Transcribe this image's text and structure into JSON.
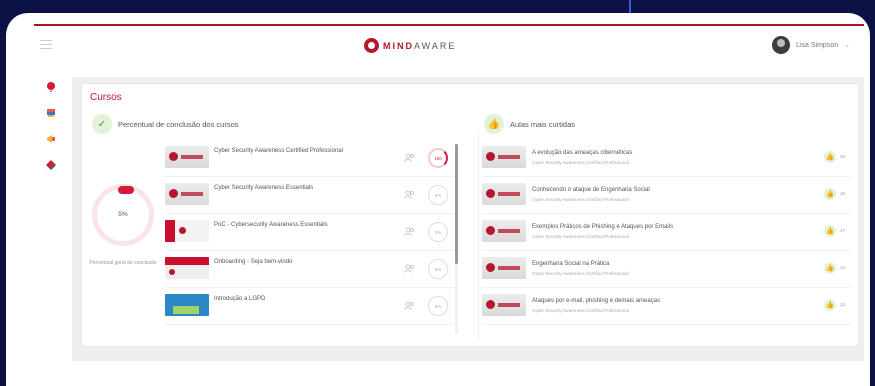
{
  "header": {
    "brand_bold": "MIND",
    "brand_rest": "AWARE",
    "user_name": "Lisa Simpson"
  },
  "sidebar": {
    "items": [
      {
        "icon": "balloon-icon"
      },
      {
        "icon": "graduation-cap-icon"
      },
      {
        "icon": "megaphone-icon"
      },
      {
        "icon": "diamond-icon"
      }
    ]
  },
  "main": {
    "title": "Cursos",
    "completion_section": {
      "heading": "Percentual de conclusão dos cursos",
      "overall_value": "5%",
      "overall_label": "Percentual geral de conclusão"
    },
    "courses": [
      {
        "title": "Cyber Security Awareness Certified Professional",
        "progress": "100",
        "progress_pct": 100,
        "thumb": "grey"
      },
      {
        "title": "Cyber Security Awareness Essentials",
        "progress": "0%",
        "progress_pct": 0,
        "thumb": "grey"
      },
      {
        "title": "PoC - Cybersecurity Awareness Essentials",
        "progress": "0%",
        "progress_pct": 0,
        "thumb": "poc"
      },
      {
        "title": "Onboarding - Seja bem-vindo",
        "progress": "0%",
        "progress_pct": 0,
        "thumb": "onb"
      },
      {
        "title": "Introdução a LGPD",
        "progress": "0%",
        "progress_pct": 0,
        "thumb": "lgpd"
      }
    ],
    "liked_section": {
      "heading": "Aulas mais curtidas",
      "lessons": [
        {
          "title": "A evolução das ameaças cibernéticas",
          "course": "Cyber Security Awareness Certified Professional",
          "likes": "25"
        },
        {
          "title": "Conhecendo o ataque de Engenharia Social",
          "course": "Cyber Security Awareness Certified Professional",
          "likes": "19"
        },
        {
          "title": "Exemplos Práticos de Phishing e Ataques por Emails",
          "course": "Cyber Security Awareness Certified Professional",
          "likes": "17"
        },
        {
          "title": "Engenharia Social na Prática",
          "course": "Cyber Security Awareness Certified Professional",
          "likes": "12"
        },
        {
          "title": "Ataques por e-mail, phishing e demais ameaças",
          "course": "Cyber Security Awareness Certified Professional",
          "likes": "12"
        }
      ]
    }
  },
  "colors": {
    "brand": "#b5172f",
    "accent_green": "#3f9a25",
    "background": "#0d1246"
  }
}
